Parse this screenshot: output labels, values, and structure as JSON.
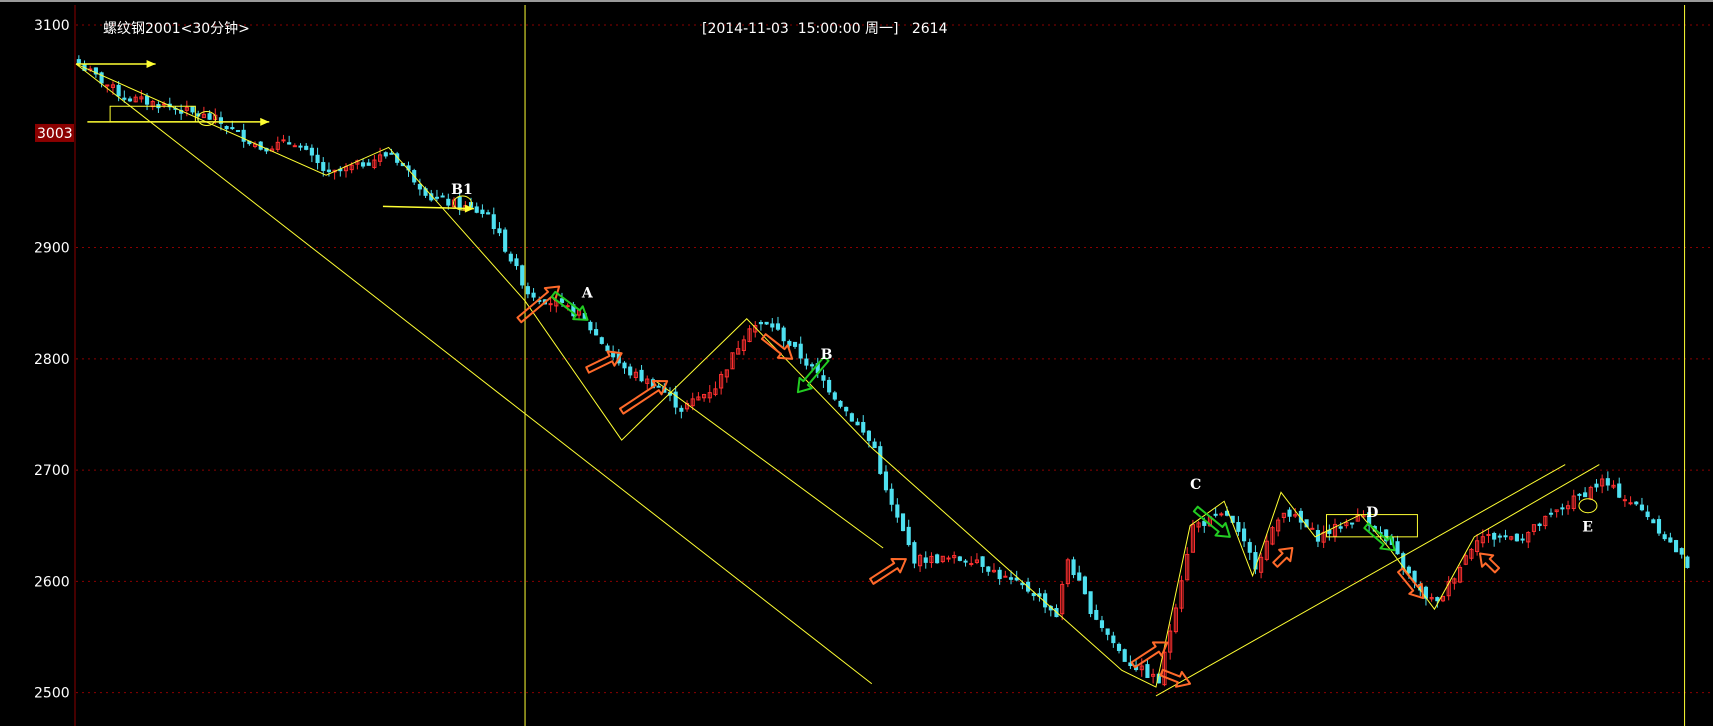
{
  "header": {
    "title": "螺纹钢2001<30分钟>",
    "cursor_info": "[2014-11-03  15:00:00 周一]   2614"
  },
  "colors": {
    "background": "#000000",
    "up_candle": "#ff3030",
    "down_candle": "#4fe0f0",
    "grid": "#8b0000",
    "annotation_line": "#ffff33",
    "orange_arrow": "#ff6a2a",
    "green_arrow": "#22cc22",
    "price_tag": "#8b0000"
  },
  "chart_data": {
    "type": "candlestick",
    "yticks": [
      {
        "label": "3100",
        "value": 3100
      },
      {
        "label": "2900",
        "value": 2900
      },
      {
        "label": "2800",
        "value": 2800
      },
      {
        "label": "2700",
        "value": 2700
      },
      {
        "label": "2600",
        "value": 2600
      },
      {
        "label": "2500",
        "value": 2500
      }
    ],
    "ylim": [
      2470,
      3118
    ],
    "xlim": [
      0,
      288
    ],
    "price_tag": {
      "label": "3003",
      "value": 3003
    },
    "grid": true,
    "labels": [
      {
        "text": "B1",
        "x": 66,
        "y": 2948
      },
      {
        "text": "A",
        "x": 89,
        "y": 2855
      },
      {
        "text": "B",
        "x": 131,
        "y": 2800
      },
      {
        "text": "C",
        "x": 196,
        "y": 2683
      },
      {
        "text": "D",
        "x": 227,
        "y": 2658
      },
      {
        "text": "E",
        "x": 265,
        "y": 2645
      }
    ],
    "vertical_markers": [
      79,
      283
    ],
    "anchors": [
      [
        0,
        3065
      ],
      [
        8,
        3035
      ],
      [
        15,
        3028
      ],
      [
        24,
        3015
      ],
      [
        32,
        2990
      ],
      [
        38,
        2995
      ],
      [
        44,
        2965
      ],
      [
        55,
        2985
      ],
      [
        62,
        2945
      ],
      [
        72,
        2930
      ],
      [
        79,
        2860
      ],
      [
        88,
        2840
      ],
      [
        96,
        2790
      ],
      [
        102,
        2775
      ],
      [
        106,
        2755
      ],
      [
        112,
        2775
      ],
      [
        118,
        2830
      ],
      [
        122,
        2830
      ],
      [
        131,
        2780
      ],
      [
        140,
        2720
      ],
      [
        142,
        2680
      ],
      [
        147,
        2620
      ],
      [
        158,
        2620
      ],
      [
        162,
        2605
      ],
      [
        168,
        2590
      ],
      [
        172,
        2570
      ],
      [
        174,
        2620
      ],
      [
        178,
        2575
      ],
      [
        184,
        2530
      ],
      [
        190,
        2510
      ],
      [
        196,
        2650
      ],
      [
        202,
        2660
      ],
      [
        207,
        2615
      ],
      [
        212,
        2665
      ],
      [
        218,
        2640
      ],
      [
        226,
        2660
      ],
      [
        231,
        2630
      ],
      [
        236,
        2590
      ],
      [
        239,
        2580
      ],
      [
        246,
        2640
      ],
      [
        254,
        2640
      ],
      [
        262,
        2670
      ],
      [
        268,
        2690
      ],
      [
        276,
        2660
      ],
      [
        283,
        2615
      ]
    ],
    "trend_lines": [
      [
        [
          0,
          3065
        ],
        [
          140,
          2508
        ]
      ],
      [
        [
          0,
          3065
        ],
        [
          44,
          2965
        ],
        [
          55,
          2990
        ],
        [
          79,
          2852
        ],
        [
          96,
          2727
        ],
        [
          118,
          2836
        ],
        [
          140,
          2720
        ],
        [
          184,
          2520
        ],
        [
          190,
          2505
        ],
        [
          196,
          2650
        ],
        [
          202,
          2672
        ],
        [
          207,
          2605
        ],
        [
          212,
          2680
        ],
        [
          218,
          2640
        ],
        [
          226,
          2660
        ],
        [
          231,
          2630
        ],
        [
          239,
          2575
        ],
        [
          246,
          2640
        ],
        [
          268,
          2705
        ]
      ],
      [
        [
          190,
          2497
        ],
        [
          262,
          2705
        ]
      ],
      [
        [
          102,
          2780
        ],
        [
          142,
          2630
        ]
      ]
    ],
    "h_arrows": [
      [
        [
          0,
          3065
        ],
        [
          14,
          3065
        ]
      ],
      [
        [
          2,
          3013
        ],
        [
          34,
          3013
        ]
      ],
      [
        [
          54,
          2937
        ],
        [
          70,
          2935
        ]
      ]
    ],
    "boxes": [
      [
        [
          6,
          3013
        ],
        [
          21,
          3027
        ]
      ],
      [
        [
          220,
          2640
        ],
        [
          236,
          2660
        ]
      ]
    ],
    "ellipses": [
      [
        23,
        3016
      ],
      [
        68,
        2940
      ],
      [
        266,
        2668
      ]
    ],
    "orange_arrows": [
      [
        [
          78,
          2835
        ],
        [
          85,
          2865
        ]
      ],
      [
        [
          96,
          2753
        ],
        [
          104,
          2780
        ]
      ],
      [
        [
          90,
          2790
        ],
        [
          96,
          2805
        ]
      ],
      [
        [
          121,
          2820
        ],
        [
          126,
          2800
        ]
      ],
      [
        [
          140,
          2600
        ],
        [
          146,
          2620
        ]
      ],
      [
        [
          186,
          2525
        ],
        [
          192,
          2545
        ]
      ],
      [
        [
          191,
          2518
        ],
        [
          196,
          2508
        ]
      ],
      [
        [
          211,
          2615
        ],
        [
          214,
          2630
        ]
      ],
      [
        [
          233,
          2610
        ],
        [
          237,
          2585
        ]
      ],
      [
        [
          250,
          2610
        ],
        [
          247,
          2625
        ]
      ]
    ],
    "green_arrows": [
      [
        [
          84,
          2858
        ],
        [
          90,
          2835
        ]
      ],
      [
        [
          132,
          2800
        ],
        [
          127,
          2770
        ]
      ],
      [
        [
          197,
          2665
        ],
        [
          203,
          2640
        ]
      ],
      [
        [
          227,
          2650
        ],
        [
          232,
          2628
        ]
      ]
    ]
  }
}
